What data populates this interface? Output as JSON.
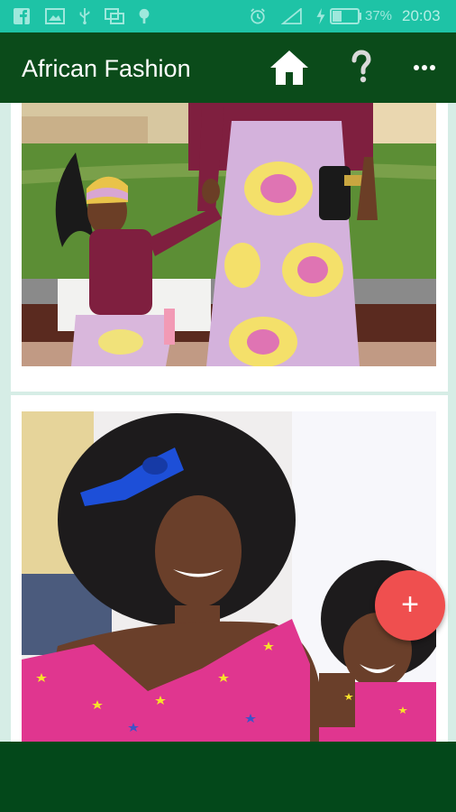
{
  "status_bar": {
    "icons": [
      "facebook-icon",
      "image-icon",
      "usb-icon",
      "cast-icon",
      "location-icon",
      "alarm-icon",
      "signal-icon",
      "charging-icon",
      "battery-icon"
    ],
    "battery_percent": "37%",
    "time": "20:03"
  },
  "app_bar": {
    "title": "African Fashion",
    "actions": [
      "home-icon",
      "help-icon",
      "more-options-icon"
    ]
  },
  "feed": {
    "items": [
      {
        "image": "photo-mother-daughter-matching-ankara"
      },
      {
        "image": "photo-mother-daughter-afro-smiling"
      }
    ]
  },
  "fab": {
    "glyph": "+",
    "icon": "add-icon"
  },
  "colors": {
    "status_bar": "#1ec3a6",
    "app_bar": "#0b4b1a",
    "content_bg": "#d6ede6",
    "fab": "#ef4f4f",
    "bottom_bar": "#03481a"
  }
}
